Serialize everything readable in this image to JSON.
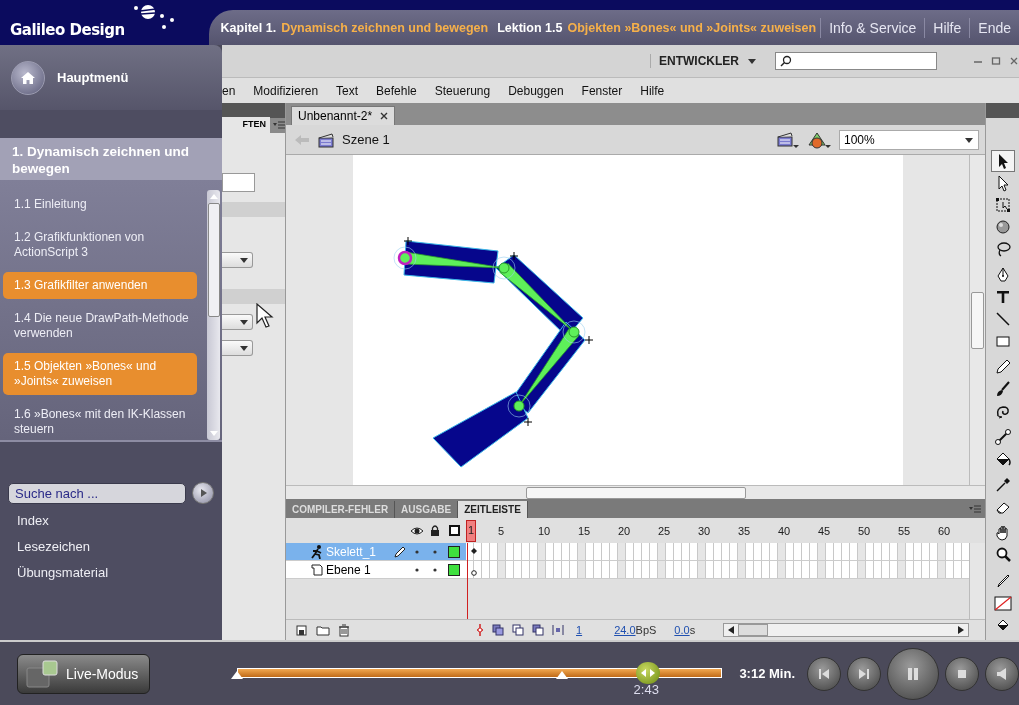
{
  "header": {
    "logo": "Galileo Design",
    "chapter_label": "Kapitel 1.",
    "chapter_title": "Dynamisch zeichnen und bewegen",
    "lesson_label": "Lektion 1.5",
    "lesson_title": "Objekten »Bones« und »Joints« zuweisen",
    "nav": [
      "Info & Service",
      "Hilfe",
      "Ende"
    ]
  },
  "sidebar": {
    "home": "Hauptmenü",
    "section": "1. Dynamisch zeichnen und bewegen",
    "lessons": [
      {
        "label": "1.1 Einleitung",
        "selected": false
      },
      {
        "label": "1.2 Grafikfunktionen von ActionScript 3",
        "selected": false
      },
      {
        "label": "1.3 Grafikfilter anwenden",
        "selected": true
      },
      {
        "label": "1.4 Die neue DrawPath-Methode verwenden",
        "selected": false
      },
      {
        "label": "1.5 Objekten »Bones« und »Joints« zuweisen",
        "selected": true
      },
      {
        "label": "1.6 »Bones« mit den IK-Klassen steuern",
        "selected": false
      }
    ],
    "search_placeholder": "Suche nach ...",
    "links": [
      "Index",
      "Lesezeichen",
      "Übungsmaterial"
    ]
  },
  "flash": {
    "workspace": "ENTWICKLER",
    "menu": [
      "en",
      "Modifizieren",
      "Text",
      "Befehle",
      "Steuerung",
      "Debuggen",
      "Fenster",
      "Hilfe"
    ],
    "panel_tab": "FTEN",
    "document_tab": "Unbenannt-2*",
    "scene": "Szene 1",
    "zoom": "100%",
    "tools": [
      {
        "selected": true
      },
      {
        "selected": false
      },
      {
        "selected": false
      },
      {
        "selected": false
      },
      {
        "selected": false
      },
      {
        "selected": false
      },
      {
        "selected": false
      },
      {
        "selected": false
      },
      {
        "selected": false
      },
      {
        "selected": false
      },
      {
        "selected": false
      },
      {
        "selected": false
      },
      {
        "selected": false
      },
      {
        "selected": false
      },
      {
        "selected": false
      },
      {
        "selected": false
      },
      {
        "selected": false
      },
      {
        "selected": false
      },
      {
        "selected": false
      },
      {
        "selected": false
      },
      {
        "selected": false
      }
    ],
    "timeline": {
      "tabs": [
        {
          "label": "COMPILER-FEHLER",
          "selected": false
        },
        {
          "label": "AUSGABE",
          "selected": false
        },
        {
          "label": "ZEITLEISTE",
          "selected": true
        }
      ],
      "frames": [
        "1",
        "5",
        "10",
        "15",
        "20",
        "25",
        "30",
        "35",
        "40",
        "45",
        "50",
        "55",
        "60"
      ],
      "layers": [
        {
          "name": "Skelett_1",
          "kind": "armature",
          "selected": true
        },
        {
          "name": "Ebene 1",
          "kind": "normal",
          "selected": false
        }
      ],
      "current_frame": "1",
      "frame_rate": "24.0",
      "frame_rate_unit": "BpS",
      "elapsed": "0.0",
      "elapsed_unit": "s"
    }
  },
  "player": {
    "mode": "Live-Modus",
    "progress": {
      "level": 0.846
    },
    "marks": [
      {
        "level": 0
      },
      {
        "level": 0.67
      }
    ],
    "position": "2:43",
    "duration": "3:12 Min."
  }
}
